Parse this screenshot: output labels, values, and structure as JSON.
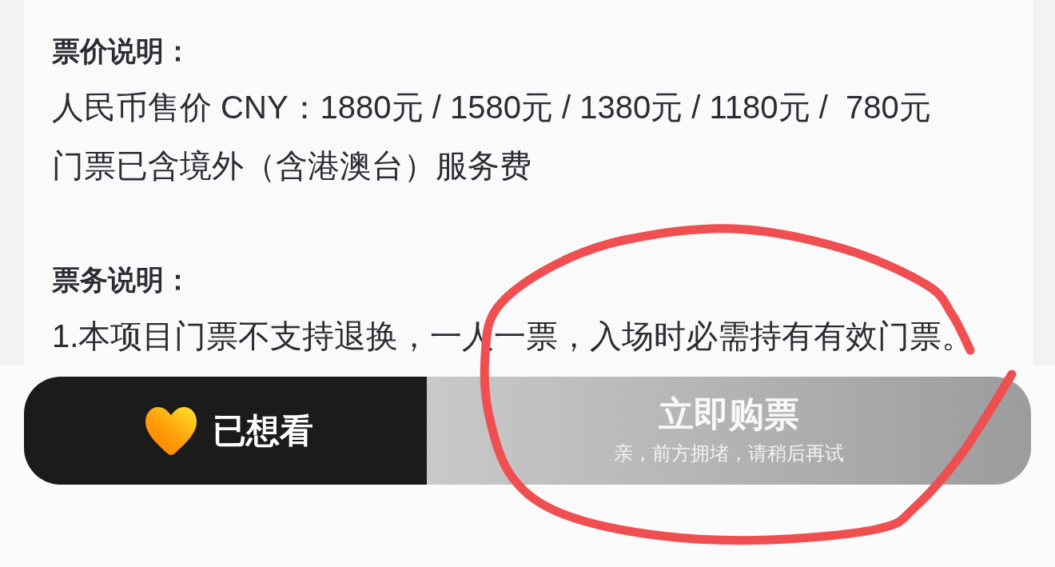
{
  "sections": [
    {
      "heading": "票价说明：",
      "lines": [
        "人民币售价 CNY：1880元 / 1580元 / 1380元 / 1180元 /  780元",
        "门票已含境外（含港澳台）服务费"
      ]
    },
    {
      "heading": "票务说明：",
      "lines": [
        "1.本项目门票不支持退换，一人一票，入场时必需持有有效门票。"
      ]
    }
  ],
  "bottom_bar": {
    "want_button": {
      "label": "已想看",
      "wanted": true
    },
    "buy_button": {
      "label": "立即购票",
      "note": "亲，前方拥堵，请稍后再试",
      "disabled": true
    }
  }
}
